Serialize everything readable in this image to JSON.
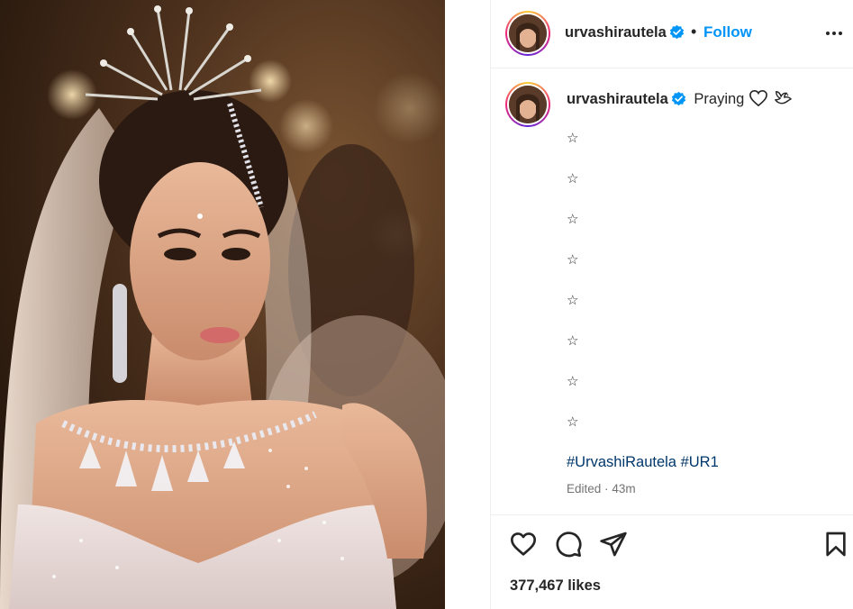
{
  "post": {
    "image_alt": "Bride with crystal crown and veil",
    "author": {
      "username": "urvashirautela",
      "verified": true,
      "avatar_icon": "profile-avatar"
    },
    "header": {
      "separator": "•",
      "follow_label": "Follow",
      "more_icon": "more-dots-icon"
    },
    "caption": {
      "text": "Praying",
      "emoji_icons": [
        "white-heart-icon",
        "dove-icon"
      ],
      "star_lines": [
        "☆",
        "☆",
        "☆",
        "☆",
        "☆",
        "☆",
        "☆",
        "☆"
      ],
      "hashtags": [
        "#UrvashiRautela",
        "#UR1"
      ],
      "edited_label": "Edited",
      "time_separator": "·",
      "time_ago": "43m"
    },
    "actions": {
      "like_icon": "heart-outline-icon",
      "comment_icon": "comment-bubble-icon",
      "share_icon": "send-paper-plane-icon",
      "save_icon": "bookmark-outline-icon"
    },
    "likes_text": "377,467 likes"
  },
  "colors": {
    "link_blue": "#0095f6",
    "hashtag_blue": "#00376b",
    "verified_blue": "#0095f6",
    "muted_gray": "#737373",
    "text_dark": "#262626",
    "divider": "#efefef"
  }
}
